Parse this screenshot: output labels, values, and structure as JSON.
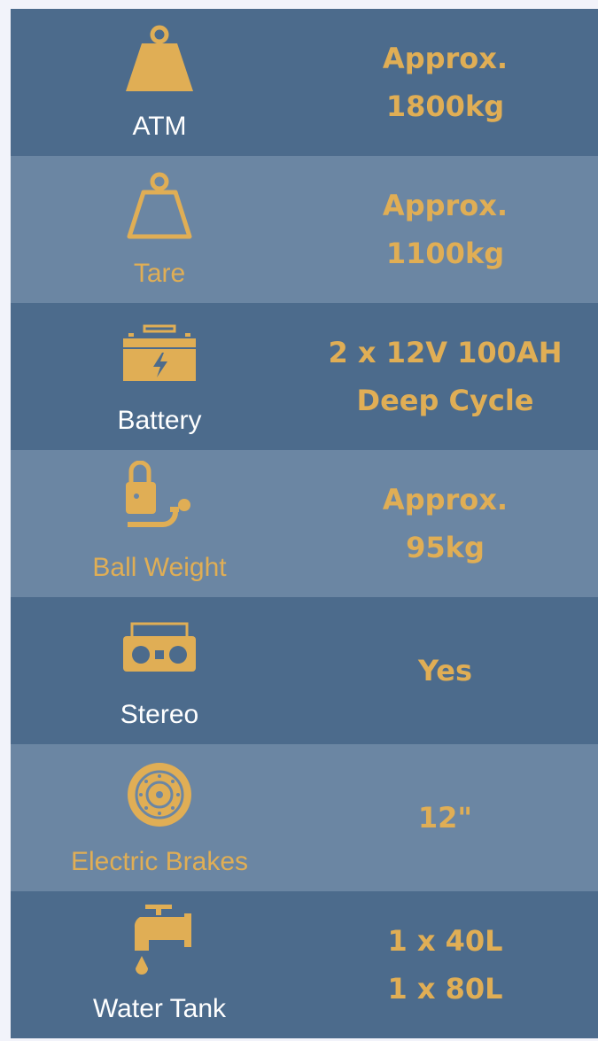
{
  "colors": {
    "dark_row": "#4c6b8c",
    "light_row": "#6b86a3",
    "accent": "#e0ae55",
    "white": "#ffffff",
    "page_bg": "#f2f3fa"
  },
  "specs": [
    {
      "icon": "weight-filled-icon",
      "label": "ATM",
      "value_line1": "Approx.",
      "value_line2": "1800kg"
    },
    {
      "icon": "weight-outline-icon",
      "label": "Tare",
      "value_line1": "Approx.",
      "value_line2": "1100kg"
    },
    {
      "icon": "battery-icon",
      "label": "Battery",
      "value_line1": "2 x 12V 100AH",
      "value_line2": "Deep Cycle"
    },
    {
      "icon": "tow-ball-icon",
      "label": "Ball Weight",
      "value_line1": "Approx.",
      "value_line2": "95kg"
    },
    {
      "icon": "stereo-icon",
      "label": "Stereo",
      "value_line1": "Yes"
    },
    {
      "icon": "brake-disc-icon",
      "label": "Electric Brakes",
      "value_line1": "12\""
    },
    {
      "icon": "water-tap-icon",
      "label": "Water Tank",
      "value_line1": "1 x 40L",
      "value_line2": "1 x 80L"
    }
  ]
}
